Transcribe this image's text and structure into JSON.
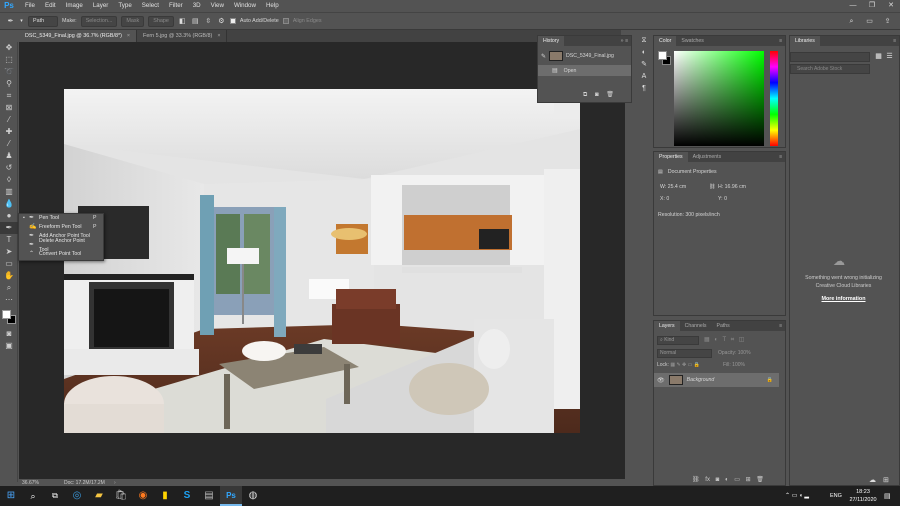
{
  "app": {
    "logo": "Ps"
  },
  "menu": [
    "File",
    "Edit",
    "Image",
    "Layer",
    "Type",
    "Select",
    "Filter",
    "3D",
    "View",
    "Window",
    "Help"
  ],
  "window_controls": {
    "minimize": "—",
    "restore": "❐",
    "close": "✕"
  },
  "options_bar": {
    "mode": "Path",
    "make_label": "Make:",
    "selection": "Selection...",
    "mask": "Mask",
    "shape": "Shape",
    "auto_add_delete": "Auto Add/Delete",
    "align_edges": "Align Edges"
  },
  "doc_tabs": [
    {
      "label": "DSC_5349_Final.jpg @ 36.7% (RGB/8*)",
      "close": "×"
    },
    {
      "label": "Fern 5.jpg @ 33.3% (RGB/8)",
      "close": "×"
    }
  ],
  "tool_flyout": [
    {
      "bullet": "▪",
      "label": "Pen Tool",
      "key": "P"
    },
    {
      "bullet": "",
      "label": "Freeform Pen Tool",
      "key": "P"
    },
    {
      "bullet": "",
      "label": "Add Anchor Point Tool",
      "key": ""
    },
    {
      "bullet": "",
      "label": "Delete Anchor Point Tool",
      "key": ""
    },
    {
      "bullet": "",
      "label": "Convert Point Tool",
      "key": ""
    }
  ],
  "status": {
    "zoom": "36.67%",
    "doc": "Doc: 17.2M/17.2M"
  },
  "history": {
    "tab": "History",
    "snapshot": "DSC_5349_Final.jpg",
    "step": "Open"
  },
  "color_panel": {
    "tabs": [
      "Color",
      "Swatches"
    ]
  },
  "properties": {
    "tabs": [
      "Properties",
      "Adjustments"
    ],
    "section": "Document Properties",
    "w_label": "W:",
    "w_value": "25.4 cm",
    "h_label": "H:",
    "h_value": "16.96 cm",
    "x_label": "X:",
    "x_value": "0",
    "y_label": "Y:",
    "y_value": "0",
    "resolution": "Resolution: 300 pixels/inch"
  },
  "layers": {
    "tabs": [
      "Layers",
      "Channels",
      "Paths"
    ],
    "kind": "Kind",
    "blend": "Normal",
    "opacity_label": "Opacity:",
    "opacity": "100%",
    "lock_label": "Lock:",
    "fill_label": "Fill:",
    "fill": "100%",
    "layer_name": "Background"
  },
  "libraries": {
    "tab": "Libraries",
    "search_placeholder": "Search Adobe Stock",
    "error_line1": "Something went wrong initializing",
    "error_line2": "Creative Cloud Libraries",
    "more_info": "More information"
  },
  "taskbar": {
    "lang": "ENG",
    "time": "18:23",
    "date": "27/11/2020"
  },
  "colors": {
    "photoshop_blue": "#31a8ff",
    "panel": "#535353",
    "dark": "#282828"
  }
}
